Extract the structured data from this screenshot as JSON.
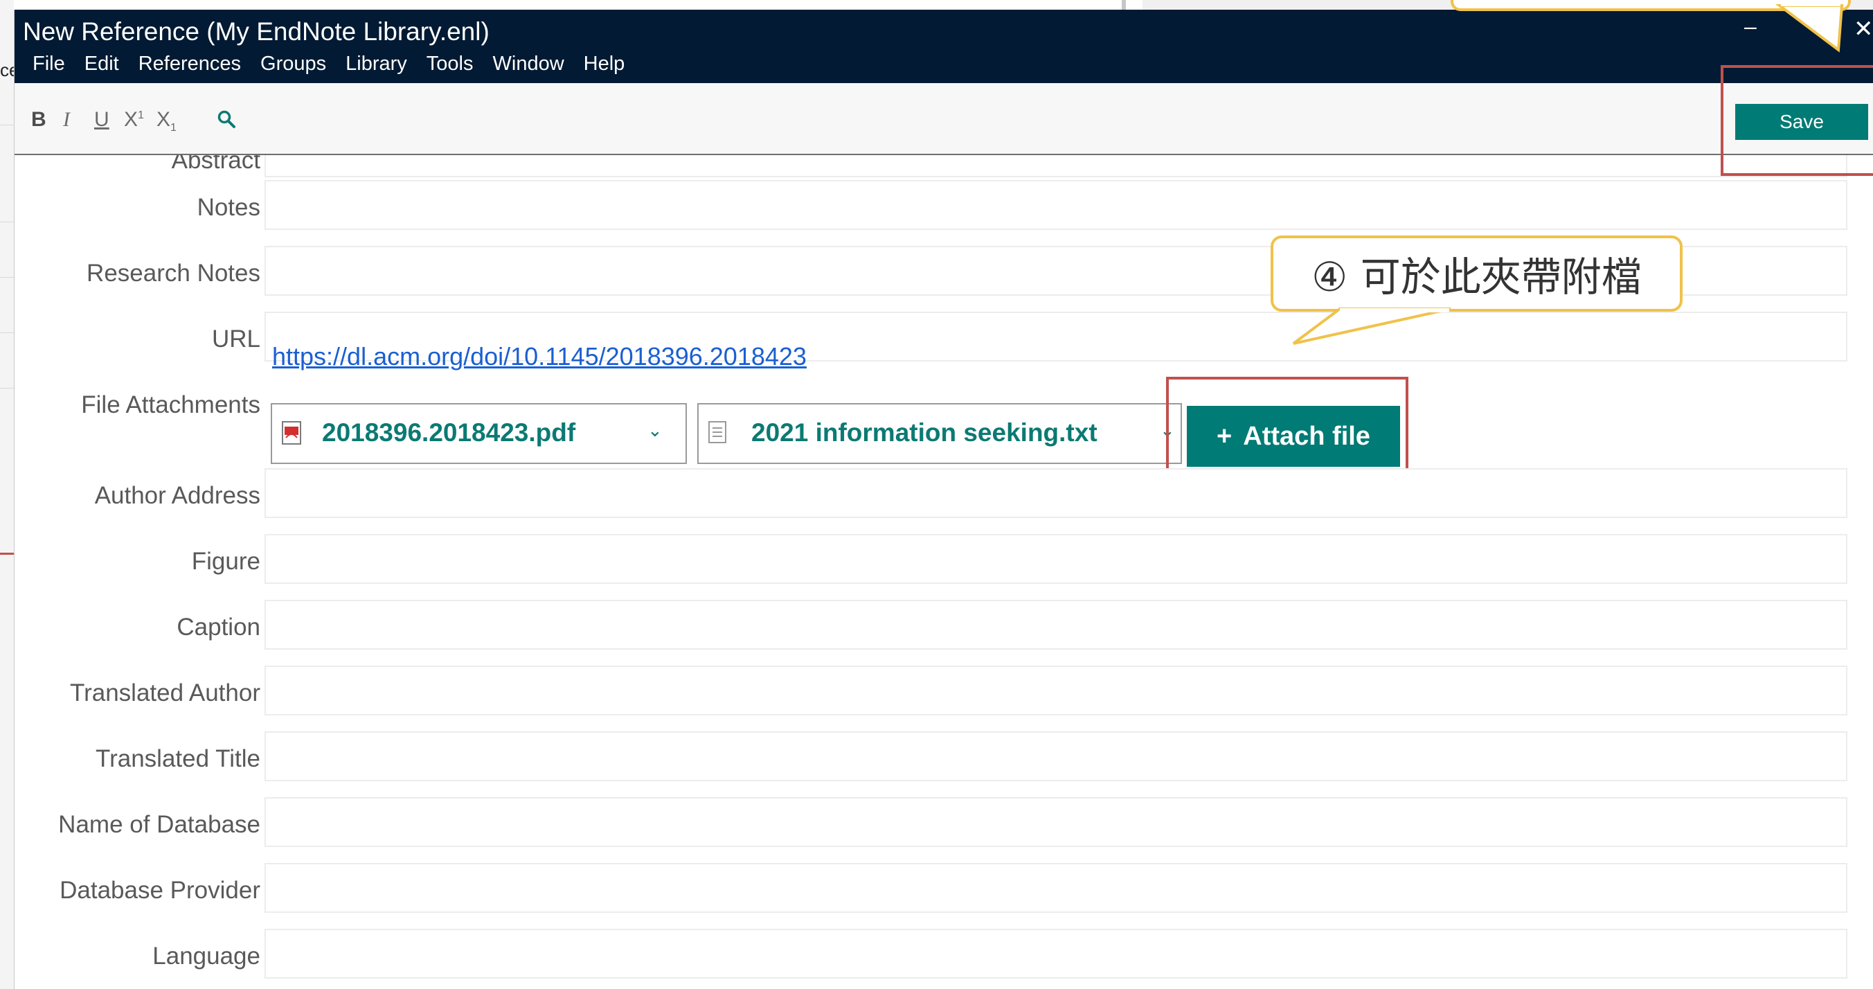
{
  "background": {
    "left_partial_text": "ce"
  },
  "window": {
    "title": "New Reference (My EndNote Library.enl)",
    "minimize": "–",
    "close": "✕"
  },
  "menu": [
    "File",
    "Edit",
    "References",
    "Groups",
    "Library",
    "Tools",
    "Window",
    "Help"
  ],
  "toolbar": {
    "bold": "B",
    "italic": "I",
    "underline": "U",
    "superscript": "X",
    "subscript": "X",
    "save_label": "Save",
    "search_icon": "search-icon"
  },
  "fields": {
    "abstract": "Abstract",
    "notes": "Notes",
    "research_notes": "Research Notes",
    "url": "URL",
    "file_attachments": "File Attachments",
    "author_address": "Author Address",
    "figure": "Figure",
    "caption": "Caption",
    "translated_author": "Translated Author",
    "translated_title": "Translated Title",
    "name_of_database": "Name of Database",
    "database_provider": "Database Provider",
    "language": "Language"
  },
  "url_value": "https://dl.acm.org/doi/10.1145/2018396.2018423",
  "attachments": [
    {
      "name": "2018396.2018423.pdf",
      "icon": "pdf-icon"
    },
    {
      "name": "2021 information seeking.txt",
      "icon": "text-file-icon"
    }
  ],
  "attach_button": {
    "plus": "+",
    "label": "Attach file"
  },
  "annotations": {
    "callout_4": "④ 可於此夾帶附檔"
  },
  "colors": {
    "titlebar": "#021a33",
    "accent": "#007b75",
    "highlight": "#c0504d",
    "callout_border": "#f0c24a",
    "link": "#1a5fd1"
  }
}
